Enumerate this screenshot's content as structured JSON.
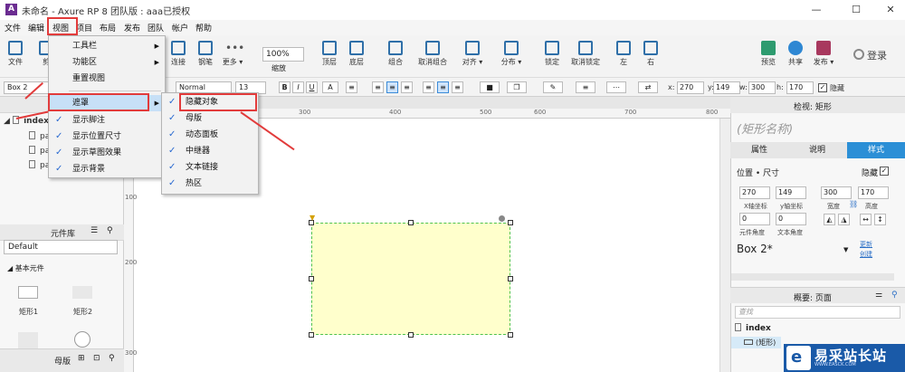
{
  "window": {
    "app_icon": "A",
    "title": "未命名 - Axure RP 8 团队版 : aaa已授权",
    "controls": [
      "—",
      "☐",
      "✕"
    ]
  },
  "menubar": [
    "文件",
    "编辑",
    "视图",
    "项目",
    "布局",
    "发布",
    "团队",
    "帐户",
    "帮助"
  ],
  "toolbar": {
    "buttons": [
      {
        "label": "文件",
        "icon": "file-icon"
      },
      {
        "label": "剪",
        "icon": "cut-icon"
      },
      {
        "label": "连接",
        "icon": "connect-icon"
      },
      {
        "label": "钢笔",
        "icon": "pen-icon"
      },
      {
        "label": "更多 ▾",
        "icon": "more-icon"
      },
      {
        "label": "顶层",
        "icon": "bring-front-icon"
      },
      {
        "label": "底层",
        "icon": "send-back-icon"
      },
      {
        "label": "组合",
        "icon": "group-icon"
      },
      {
        "label": "取消组合",
        "icon": "ungroup-icon"
      },
      {
        "label": "对齐 ▾",
        "icon": "align-icon"
      },
      {
        "label": "分布 ▾",
        "icon": "distribute-icon"
      },
      {
        "label": "锁定",
        "icon": "lock-icon"
      },
      {
        "label": "取消锁定",
        "icon": "unlock-icon"
      },
      {
        "label": "左",
        "icon": "left-icon"
      },
      {
        "label": "右",
        "icon": "right-icon"
      },
      {
        "label": "预览",
        "icon": "preview-icon"
      },
      {
        "label": "共享",
        "icon": "share-icon"
      },
      {
        "label": "发布 ▾",
        "icon": "publish-icon"
      }
    ],
    "zoom_value": "100%",
    "zoom_label": "缩放",
    "login_label": "登录"
  },
  "stylebar": {
    "shape_name": "Box 2",
    "font_style": "Normal",
    "font_size": "13",
    "bold": "B",
    "italic": "I",
    "underline": "U",
    "text_color": "A",
    "x_label": "x:",
    "x_value": "270",
    "y_label": "y:",
    "y_value": "149",
    "w_label": "w:",
    "w_value": "300",
    "h_label": "h:",
    "h_value": "170",
    "hidden_label": "隐藏",
    "hidden_check": "✓"
  },
  "pages": {
    "root": "index",
    "children": [
      "pa",
      "pa",
      "pa"
    ]
  },
  "library": {
    "title": "元件库",
    "selected": "Default",
    "section": "基本元件",
    "widgets": [
      "矩形1",
      "矩形2"
    ]
  },
  "bottom_tabs": {
    "label": "母版"
  },
  "view_menu": {
    "items": [
      {
        "label": "工具栏",
        "check": "",
        "arrow": "▶"
      },
      {
        "label": "功能区",
        "check": "",
        "arrow": "▶"
      },
      {
        "label": "重置视图",
        "check": "",
        "arrow": ""
      },
      {
        "label": "遮罩",
        "check": "",
        "arrow": "▶"
      },
      {
        "label": "显示脚注",
        "check": "✓",
        "arrow": ""
      },
      {
        "label": "显示位置尺寸",
        "check": "✓",
        "arrow": ""
      },
      {
        "label": "显示草图效果",
        "check": "✓",
        "arrow": ""
      },
      {
        "label": "显示背景",
        "check": "✓",
        "arrow": ""
      }
    ]
  },
  "mask_menu": {
    "items": [
      {
        "label": "隐藏对象",
        "check": "✓"
      },
      {
        "label": "母版",
        "check": "✓"
      },
      {
        "label": "动态面板",
        "check": "✓"
      },
      {
        "label": "中继器",
        "check": "✓"
      },
      {
        "label": "文本链接",
        "check": "✓"
      },
      {
        "label": "热区",
        "check": "✓"
      }
    ]
  },
  "rulers": {
    "top": [
      "300",
      "400",
      "500",
      "600",
      "700",
      "800"
    ],
    "left": [
      "100",
      "200",
      "300"
    ]
  },
  "inspector": {
    "header": "检视: 矩形",
    "shape_name_placeholder": "(矩形名称)",
    "tabs": [
      "属性",
      "说明",
      "样式"
    ],
    "position_size": "位置 • 尺寸",
    "hidden_label": "隐藏",
    "hidden_check": "✓",
    "x": "270",
    "y": "149",
    "w": "300",
    "h": "170",
    "x_label": "X轴坐标",
    "y_label": "y轴坐标",
    "w_label": "宽度",
    "h_label": "高度",
    "rot_elem": "0",
    "rot_text": "0",
    "rot_elem_label": "元件角度",
    "rot_text_label": "文本角度",
    "style_name": "Box 2*",
    "link_update": "更新",
    "link_create": "创建"
  },
  "outline": {
    "tabs": "概要: 页面",
    "search_placeholder": "查找",
    "root": "index",
    "item": "(矩形)"
  },
  "watermark": {
    "logo_letter": "e",
    "text": "易采站长站",
    "sub": "WWW.EASCK.COM"
  },
  "colors": {
    "accent": "#2b8fd6",
    "highlight_red": "#e23b3b",
    "shape_fill": "#ffffcc",
    "selection_border": "#4ec24e"
  }
}
